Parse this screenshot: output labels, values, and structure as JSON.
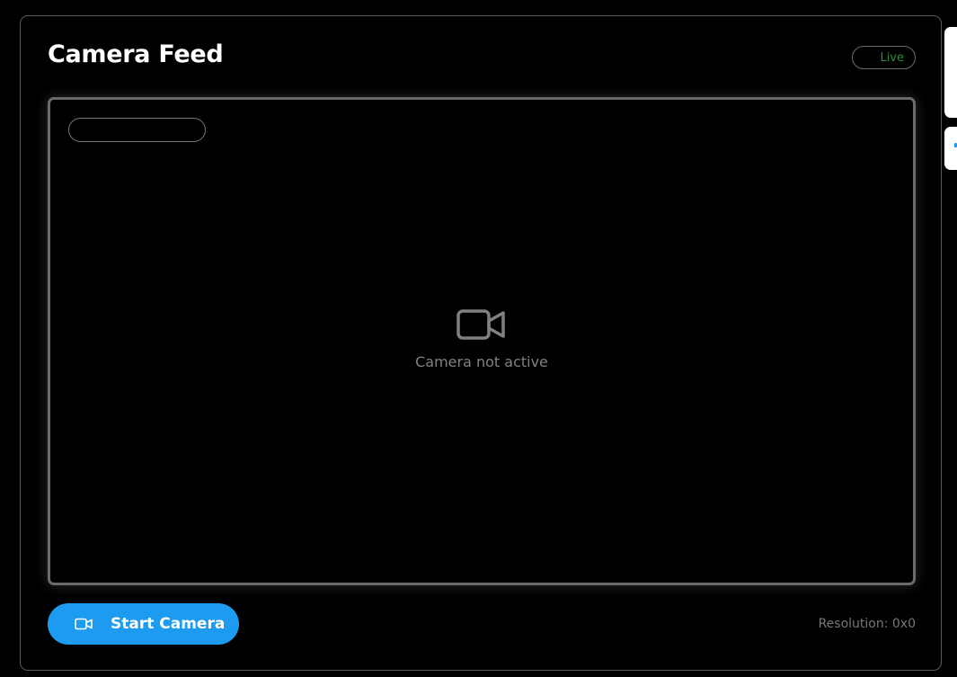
{
  "header": {
    "title": "Camera Feed",
    "status_badge": "Live",
    "status_color": "#2e8b3a"
  },
  "viewport": {
    "overlay_label": "",
    "empty_icon": "video-camera-icon",
    "empty_message": "Camera not active"
  },
  "controls": {
    "start_button_label": "Start Camera",
    "start_button_icon": "video-camera-icon",
    "accent_color": "#1d9bf0",
    "resolution_text": "Resolution: 0x0"
  }
}
